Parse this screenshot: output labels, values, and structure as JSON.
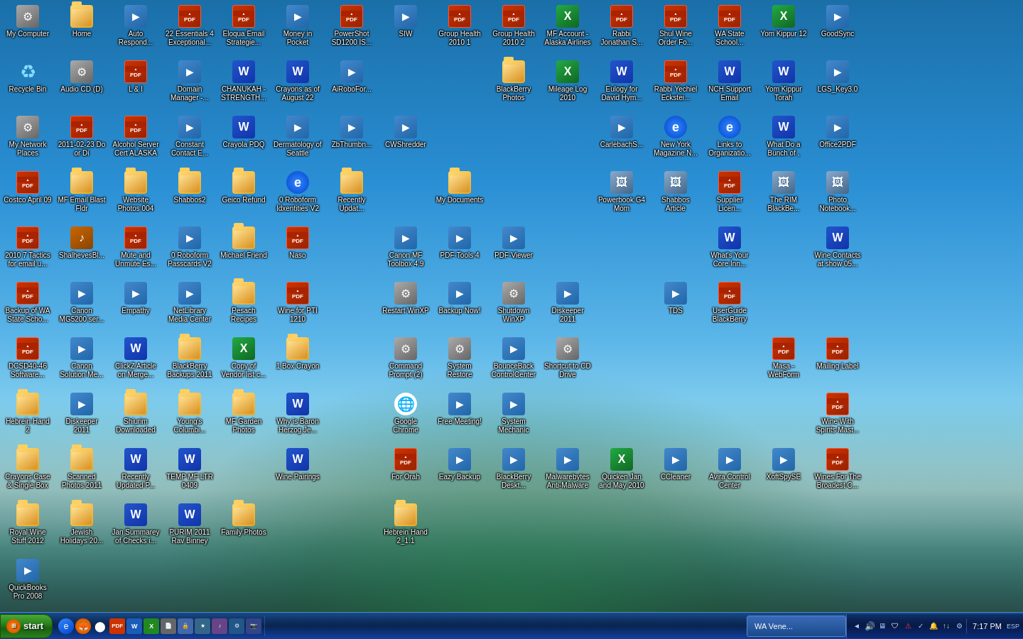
{
  "desktop": {
    "background": "tropical beach",
    "icons": [
      {
        "id": "my-computer",
        "label": "My Computer",
        "type": "sys",
        "col": 1
      },
      {
        "id": "home",
        "label": "Home",
        "type": "folder",
        "col": 1
      },
      {
        "id": "auto-respond",
        "label": "Auto Respond...",
        "type": "app",
        "col": 1
      },
      {
        "id": "22-essentials",
        "label": "22 Essentials 4 Exceptional...",
        "type": "pdf",
        "col": 1
      },
      {
        "id": "eloqua",
        "label": "Eloqua Email Strategie...",
        "type": "pdf",
        "col": 1
      },
      {
        "id": "money-pocket",
        "label": "Money in Pocket",
        "type": "app",
        "col": 1
      },
      {
        "id": "powershot",
        "label": "PowerShot SD1200 IS...",
        "type": "pdf",
        "col": 1
      },
      {
        "id": "siw",
        "label": "SIW",
        "type": "app",
        "col": 1
      },
      {
        "id": "group-health-1",
        "label": "Group Health 2010 1",
        "type": "pdf",
        "col": 1
      },
      {
        "id": "group-health-2",
        "label": "Group Health 2010 2",
        "type": "pdf",
        "col": 1
      },
      {
        "id": "mf-account-alaska",
        "label": "MF Account - Alaska Airlines",
        "type": "excel",
        "col": 1
      },
      {
        "id": "rabbi-jonathan",
        "label": "Rabbi Jonathan S...",
        "type": "pdf",
        "col": 1
      },
      {
        "id": "shul-wine",
        "label": "Shul Wine Order Fo...",
        "type": "pdf",
        "col": 1
      },
      {
        "id": "wa-state-school",
        "label": "WA State School...",
        "type": "pdf",
        "col": 1
      },
      {
        "id": "yom-kippur-12",
        "label": "Yom Kippur 12",
        "type": "excel",
        "col": 1
      },
      {
        "id": "goodsync",
        "label": "GoodSync",
        "type": "app",
        "col": 1
      },
      {
        "id": "recycle-bin",
        "label": "Recycle Bin",
        "type": "recycle",
        "col": 2
      },
      {
        "id": "audio-cd",
        "label": "Audio CD (D)",
        "type": "sys",
        "col": 2
      },
      {
        "id": "l-and-i",
        "label": "L & I",
        "type": "pdf",
        "col": 2
      },
      {
        "id": "domain-manager",
        "label": "Domain Manager -...",
        "type": "app",
        "col": 2
      },
      {
        "id": "chanukah",
        "label": "CHANUKAH - STRENGTH...",
        "type": "word",
        "col": 2
      },
      {
        "id": "crayons-aug",
        "label": "Crayons as of August 22",
        "type": "word",
        "col": 2
      },
      {
        "id": "airobofor",
        "label": "AiRoboFor...",
        "type": "app",
        "col": 2
      },
      {
        "id": "blackberry-photos",
        "label": "BlackBerry Photos",
        "type": "folder",
        "col": 2
      },
      {
        "id": "mileage-log",
        "label": "Mileage Log 2010",
        "type": "excel",
        "col": 2
      },
      {
        "id": "eulogy-david",
        "label": "Eulogy for David Hym...",
        "type": "word",
        "col": 2
      },
      {
        "id": "rabbi-yechiel",
        "label": "Rabbi Yechiel Eckstei...",
        "type": "pdf",
        "col": 2
      },
      {
        "id": "nch-support",
        "label": "NCH Support Email",
        "type": "word",
        "col": 2
      },
      {
        "id": "yom-kippur-torah",
        "label": "Yom Kippur Torah",
        "type": "word",
        "col": 2
      },
      {
        "id": "lgs-key",
        "label": "LGS_Key3.0",
        "type": "app",
        "col": 2
      },
      {
        "id": "my-network",
        "label": "My Network Places",
        "type": "sys",
        "col": 3
      },
      {
        "id": "2011-02-23",
        "label": "2011-02-23 Do or Di",
        "type": "pdf",
        "col": 3
      },
      {
        "id": "alcohol-server",
        "label": "Alcohol Server Cert ALASKA",
        "type": "pdf",
        "col": 3
      },
      {
        "id": "constant-contact",
        "label": "Constant Contact E...",
        "type": "app",
        "col": 3
      },
      {
        "id": "crayola-pdq",
        "label": "Crayola PDQ",
        "type": "word",
        "col": 3
      },
      {
        "id": "dermatology",
        "label": "Dermatology of Seattle",
        "type": "app",
        "col": 3
      },
      {
        "id": "zbthumbn",
        "label": "ZbThumbn...",
        "type": "app",
        "col": 3
      },
      {
        "id": "carlebach-s",
        "label": "CarlebachS...",
        "type": "app",
        "col": 3
      },
      {
        "id": "new-york-magazine",
        "label": "New York Magazine N...",
        "type": "ie",
        "col": 3
      },
      {
        "id": "links-to-organizations",
        "label": "Links to Organizatio...",
        "type": "ie",
        "col": 3
      },
      {
        "id": "what-do-bunch",
        "label": "What Do a Bunch of ,",
        "type": "word",
        "col": 3
      },
      {
        "id": "office2pdf",
        "label": "Office2PDF",
        "type": "app",
        "col": 3
      },
      {
        "id": "costco-april",
        "label": "Costco April 09",
        "type": "pdf",
        "col": 3
      },
      {
        "id": "mf-email-blast",
        "label": "MF Email Blast Fldr",
        "type": "folder",
        "col": 3
      },
      {
        "id": "website-photos",
        "label": "Website Photos 004",
        "type": "folder",
        "col": 3
      },
      {
        "id": "shabbos2",
        "label": "Shabbos2",
        "type": "folder",
        "col": 3
      },
      {
        "id": "geico-refund",
        "label": "Geico Refund",
        "type": "folder",
        "col": 3
      },
      {
        "id": "0-roboform-id",
        "label": "0 Roboform Idxentities V2",
        "type": "ie",
        "col": 3
      },
      {
        "id": "recently-updat",
        "label": "Recently Updat...",
        "type": "folder",
        "col": 3
      },
      {
        "id": "powerbook-g4",
        "label": "Powerbook G4 Mom",
        "type": "img",
        "col": 3
      },
      {
        "id": "shabbos-article",
        "label": "Shabbos Article",
        "type": "img",
        "col": 3
      },
      {
        "id": "supplier-licen",
        "label": "Supplier Licen...",
        "type": "pdf",
        "col": 3
      },
      {
        "id": "the-rim-blackberry",
        "label": "The RIM BlackBe...",
        "type": "img",
        "col": 3
      },
      {
        "id": "photo-notebook",
        "label": "Photo Notebook...",
        "type": "img",
        "col": 3
      },
      {
        "id": "2010-7-tactics",
        "label": "2010 7 Tactics for email u...",
        "type": "pdf",
        "col": 4
      },
      {
        "id": "shalheves",
        "label": "ShalhevesBl...",
        "type": "mp3",
        "col": 4
      },
      {
        "id": "mute-unmute",
        "label": "Mute and Unmute Es...",
        "type": "pdf",
        "col": 4
      },
      {
        "id": "0-roboform-pass",
        "label": "0 Roboform Passcards V2",
        "type": "app",
        "col": 4
      },
      {
        "id": "michael-friend",
        "label": "Michael Friend",
        "type": "folder",
        "col": 4
      },
      {
        "id": "naso",
        "label": "Naso",
        "type": "pdf",
        "col": 4
      },
      {
        "id": "whats-your-core",
        "label": "What's Your Core Inn...",
        "type": "word",
        "col": 4
      },
      {
        "id": "wine-contacts",
        "label": "Wine Contacts at show 05...",
        "type": "word",
        "col": 4
      },
      {
        "id": "backup-wa-state",
        "label": "Backup of WA State Scho...",
        "type": "pdf",
        "col": 4
      },
      {
        "id": "canon-mg5200",
        "label": "Canon MG5200 ser...",
        "type": "app",
        "col": 4
      },
      {
        "id": "empathy",
        "label": "Empathy",
        "type": "app",
        "col": 4
      },
      {
        "id": "netlibrary",
        "label": "NetLibrary Media Center",
        "type": "app",
        "col": 4
      },
      {
        "id": "pesach-recipes",
        "label": "Pesach Recipes",
        "type": "folder",
        "col": 4
      },
      {
        "id": "wine-for-pti",
        "label": "Wine for PTI 1210",
        "type": "pdf",
        "col": 4
      },
      {
        "id": "tds",
        "label": "TDS",
        "type": "app",
        "col": 4
      },
      {
        "id": "userguide-blackberry",
        "label": "UserGuide BlackBerry",
        "type": "pdf",
        "col": 4
      },
      {
        "id": "dcsd40-46",
        "label": "DCSD40-46 Software...",
        "type": "pdf",
        "col": 4
      },
      {
        "id": "canon-solution",
        "label": "Canon Solution Me...",
        "type": "app",
        "col": 4
      },
      {
        "id": "clickz-article",
        "label": "ClickZ Article on Merge...",
        "type": "word",
        "col": 4
      },
      {
        "id": "blackberry-backups",
        "label": "BlackBerry Backups 2011",
        "type": "folder",
        "col": 4
      },
      {
        "id": "copy-vendor-list",
        "label": "Copy of Vendor list c...",
        "type": "excel",
        "col": 4
      },
      {
        "id": "1-box-crayon",
        "label": "1 Box Crayon",
        "type": "folder",
        "col": 4
      },
      {
        "id": "masa-webform",
        "label": "Masa - WebForm",
        "type": "pdf",
        "col": 4
      },
      {
        "id": "mailing-label",
        "label": "Mailing Label",
        "type": "pdf",
        "col": 4
      },
      {
        "id": "hebrein-hand-2",
        "label": "Hebrein Hand 2",
        "type": "folder",
        "col": 4
      },
      {
        "id": "diskeeper-2011-2",
        "label": "Diskeeper 2011",
        "type": "app",
        "col": 4
      },
      {
        "id": "shiurim-downloaded",
        "label": "Shiurim Downloaded",
        "type": "folder",
        "col": 4
      },
      {
        "id": "youngs-columbia",
        "label": "Young's Columbi...",
        "type": "folder",
        "col": 4
      },
      {
        "id": "mf-garden-photos",
        "label": "MF Garden Photos",
        "type": "folder",
        "col": 4
      },
      {
        "id": "why-baron-herzog",
        "label": "Why is Baron Herzog Je...",
        "type": "word",
        "col": 4
      },
      {
        "id": "wine-with-spirits",
        "label": "Wine With Spirits Mast...",
        "type": "pdf",
        "col": 4
      },
      {
        "id": "crayons-case",
        "label": "Crayons Case & Single Box",
        "type": "folder",
        "col": 4
      },
      {
        "id": "scanned-photos",
        "label": "Scanned Photos 2011",
        "type": "folder",
        "col": 4
      },
      {
        "id": "recently-updated-p",
        "label": "Recently Updated P...",
        "type": "word",
        "col": 4
      },
      {
        "id": "temp-mf-ltr",
        "label": "TEMP MF LTR 0409",
        "type": "word",
        "col": 4
      },
      {
        "id": "wines-broadest",
        "label": "Wines For The Broadest C...",
        "type": "pdf",
        "col": 4
      },
      {
        "id": "royal-wine",
        "label": "Royal Wine Stuff 2012",
        "type": "folder",
        "col": 4
      },
      {
        "id": "jewish-holidays",
        "label": "Jewish Holidays 20...",
        "type": "folder",
        "col": 4
      },
      {
        "id": "jan-summarey",
        "label": "Jan Summarey of Checks i...",
        "type": "word",
        "col": 4
      },
      {
        "id": "purim-2011",
        "label": "PURIM 2011 Rav Binney",
        "type": "word",
        "col": 4
      },
      {
        "id": "family-photos",
        "label": "Family Photos",
        "type": "folder",
        "col": 4
      },
      {
        "id": "quickbooks",
        "label": "QuickBooks Pro 2008",
        "type": "app",
        "col": 4
      },
      {
        "id": "cwshredder",
        "label": "CWShredder",
        "type": "app",
        "col": 5
      },
      {
        "id": "my-documents",
        "label": "My Documents",
        "type": "folder",
        "col": 5
      },
      {
        "id": "canon-mf-toolbox",
        "label": "Canon MF Toolbox 4.9",
        "type": "app",
        "col": 5
      },
      {
        "id": "pdf-tools-4",
        "label": "PDF-Tools 4",
        "type": "app",
        "col": 5
      },
      {
        "id": "pdf-viewer",
        "label": "PDF-Viewer",
        "type": "app",
        "col": 5
      },
      {
        "id": "restart-winxp",
        "label": "Restart WinXP",
        "type": "sys",
        "col": 5
      },
      {
        "id": "backup-now",
        "label": "Backup Now!",
        "type": "app",
        "col": 5
      },
      {
        "id": "shutdown-winxp",
        "label": "Shutdown WinXP",
        "type": "sys",
        "col": 5
      },
      {
        "id": "diskeeper-2011",
        "label": "Diskeeper 2011",
        "type": "app",
        "col": 5
      },
      {
        "id": "command-prompt",
        "label": "Command Prompt (2)",
        "type": "sys",
        "col": 5
      },
      {
        "id": "system-restore",
        "label": "System Restore",
        "type": "sys",
        "col": 5
      },
      {
        "id": "bounceback",
        "label": "BounceBack ControlCenter",
        "type": "app",
        "col": 5
      },
      {
        "id": "shortcut-cd",
        "label": "Shortcut to CD Drive",
        "type": "sys",
        "col": 5
      },
      {
        "id": "google-chrome",
        "label": "Google Chrome",
        "type": "chrome",
        "col": 5
      },
      {
        "id": "free-meeting",
        "label": "Free Meeting!",
        "type": "app",
        "col": 5
      },
      {
        "id": "system-mechanic",
        "label": "System Mechanic",
        "type": "app",
        "col": 5
      },
      {
        "id": "for-orah",
        "label": "For Orah",
        "type": "pdf",
        "col": 5
      },
      {
        "id": "eazy-backup",
        "label": "Eazy Backup",
        "type": "app",
        "col": 5
      },
      {
        "id": "blackberry-desktop",
        "label": "BlackBerry Deskt...",
        "type": "app",
        "col": 5
      },
      {
        "id": "malwarebytes",
        "label": "Malwarebytes Anti-Malware",
        "type": "app",
        "col": 5
      },
      {
        "id": "quicken-jan",
        "label": "Quicken Jan and May 2010",
        "type": "excel",
        "col": 5
      },
      {
        "id": "ccleaner",
        "label": "CCleaner",
        "type": "app",
        "col": 5
      },
      {
        "id": "avira-control",
        "label": "Avira Control Center",
        "type": "app",
        "col": 5
      },
      {
        "id": "xoftspyse",
        "label": "XoftSpySE",
        "type": "app",
        "col": 5
      },
      {
        "id": "hebrein-hand-2-1-1",
        "label": "Hebrein Hand 2_1.1",
        "type": "folder",
        "col": 5
      },
      {
        "id": "wine-pairings",
        "label": "Wine Pairings",
        "type": "word",
        "col": 5
      }
    ]
  },
  "taskbar": {
    "start_label": "start",
    "window_label": "WA Vene...",
    "time": "7:17 PM",
    "tray_icons": [
      "speaker",
      "network",
      "antivirus",
      "security",
      "clock"
    ]
  }
}
